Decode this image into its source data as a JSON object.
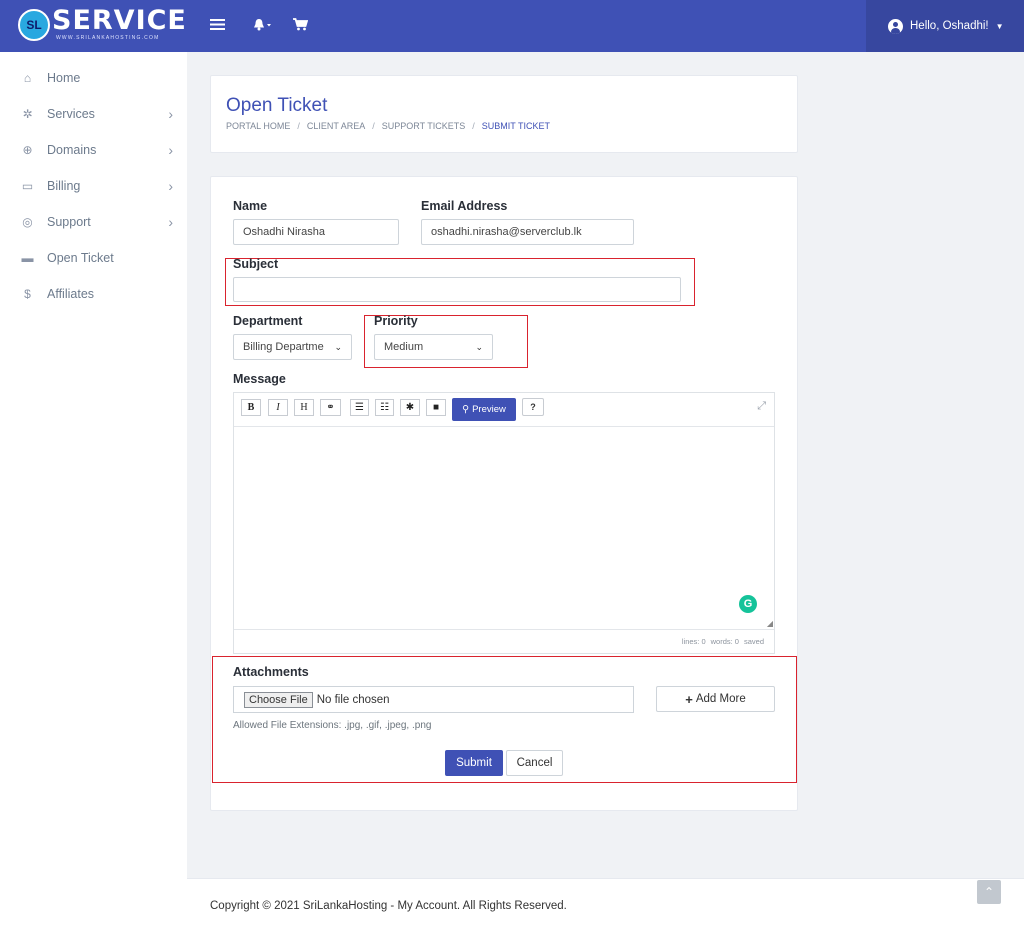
{
  "brand": {
    "badge": "SL",
    "name": "SERVICE",
    "tagline": "WWW.SRILANKAHOSTING.COM"
  },
  "header": {
    "greeting": "Hello, Oshadhi!"
  },
  "sidebar": {
    "items": [
      {
        "label": "Home",
        "icon": "home-icon",
        "chevron": false
      },
      {
        "label": "Services",
        "icon": "cog-icon",
        "chevron": true
      },
      {
        "label": "Domains",
        "icon": "globe-icon",
        "chevron": true
      },
      {
        "label": "Billing",
        "icon": "credit-card-icon",
        "chevron": true
      },
      {
        "label": "Support",
        "icon": "life-ring-icon",
        "chevron": true
      },
      {
        "label": "Open Ticket",
        "icon": "ticket-icon",
        "chevron": false
      },
      {
        "label": "Affiliates",
        "icon": "dollar-icon",
        "chevron": false
      }
    ]
  },
  "page": {
    "title": "Open Ticket",
    "breadcrumb": [
      "PORTAL HOME",
      "CLIENT AREA",
      "SUPPORT TICKETS",
      "SUBMIT TICKET"
    ]
  },
  "form": {
    "name_label": "Name",
    "name_value": "Oshadhi Nirasha",
    "email_label": "Email Address",
    "email_value": "oshadhi.nirasha@serverclub.lk",
    "subject_label": "Subject",
    "subject_value": "",
    "department_label": "Department",
    "department_value": "Billing Departme",
    "priority_label": "Priority",
    "priority_value": "Medium",
    "message_label": "Message",
    "attachments_label": "Attachments",
    "choose_file": "Choose File",
    "no_file": "No file chosen",
    "add_more": "Add More",
    "allowed_ext": "Allowed File Extensions: .jpg, .gif, .jpeg, .png",
    "submit": "Submit",
    "cancel": "Cancel"
  },
  "editor": {
    "toolbar": [
      "B",
      "I",
      "H"
    ],
    "preview": "Preview",
    "status": {
      "lines": "lines: 0",
      "words": "words: 0",
      "saved": "saved"
    }
  },
  "footer": {
    "copyright": "Copyright © 2021 SriLankaHosting - My Account. All Rights Reserved."
  },
  "colors": {
    "primary": "#3f51b5",
    "header_dark": "#37479f",
    "highlight_red": "#d9232e",
    "grammarly": "#15c39a"
  }
}
